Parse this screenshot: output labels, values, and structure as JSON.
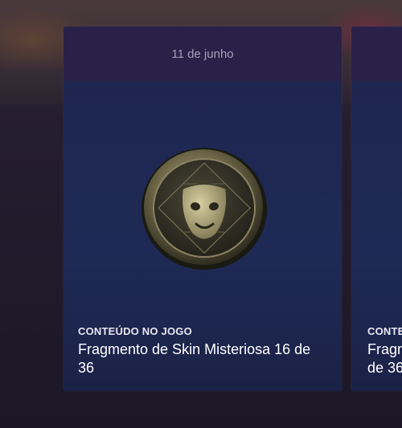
{
  "cards": [
    {
      "date": "11 de junho",
      "category": "CONTEÚDO NO JOGO",
      "title": "Fragmento de Skin Misteriosa 16 de 36",
      "icon": "theater-mask-coin-icon"
    },
    {
      "category": "CONTE",
      "title_line1": "Fragm",
      "title_line2": "de 36"
    }
  ]
}
